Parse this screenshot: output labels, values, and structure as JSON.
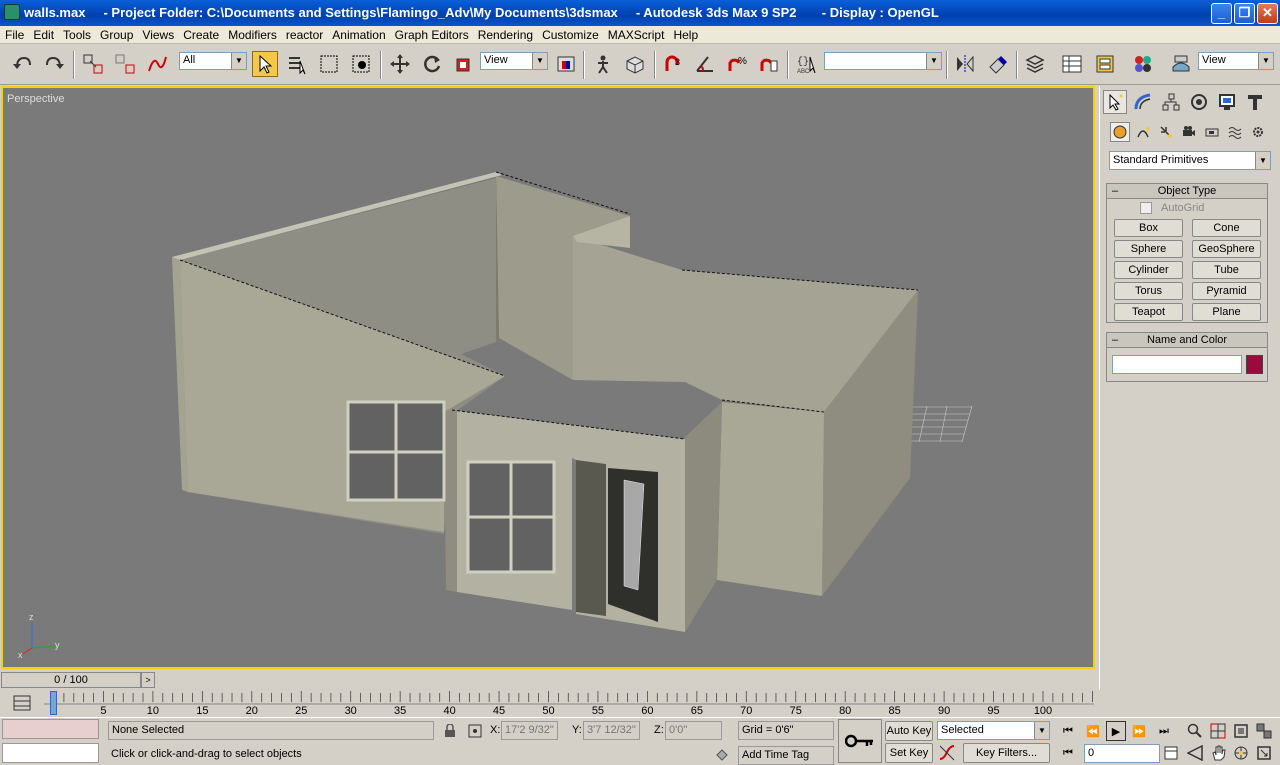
{
  "window": {
    "title": "walls.max     - Project Folder: C:\\Documents and Settings\\Flamingo_Adv\\My Documents\\3dsmax     - Autodesk 3ds Max 9 SP2       - Display : OpenGL",
    "minimize": "_",
    "maximize": "❐",
    "close": "✕"
  },
  "menu": [
    "File",
    "Edit",
    "Tools",
    "Group",
    "Views",
    "Create",
    "Modifiers",
    "reactor",
    "Animation",
    "Graph Editors",
    "Rendering",
    "Customize",
    "MAXScript",
    "Help"
  ],
  "toolbar": {
    "selection_filter": "All",
    "ref_coord": "View",
    "named_selection": "",
    "render_view": "View",
    "icons": [
      "undo-icon",
      "redo-icon",
      "select-link-icon",
      "unlink-icon",
      "bind-space-warp-icon",
      "select-object-icon",
      "select-by-name-icon",
      "rect-region-icon",
      "window-crossing-icon",
      "move-icon",
      "rotate-icon",
      "scale-icon",
      "pivot-icon",
      "manipulate-icon",
      "keyboard-shortcut-icon",
      "snaps-icon",
      "angle-snap-icon",
      "percent-snap-icon",
      "spinner-snap-icon",
      "edit-named-sets-icon",
      "mirror-icon",
      "align-icon",
      "layer-manager-icon",
      "curve-editor-icon",
      "schematic-view-icon",
      "material-editor-icon",
      "render-scene-icon",
      "quick-render-icon"
    ]
  },
  "viewport": {
    "label": "Perspective",
    "axis": {
      "x": "x",
      "y": "y",
      "z": "z"
    }
  },
  "command_panel": {
    "tabs": [
      "create-tab-icon",
      "modify-tab-icon",
      "hierarchy-tab-icon",
      "motion-tab-icon",
      "display-tab-icon",
      "utilities-tab-icon"
    ],
    "subtabs": [
      "geometry-icon",
      "shapes-icon",
      "lights-icon",
      "cameras-icon",
      "helpers-icon",
      "space-warps-icon",
      "systems-icon"
    ],
    "category": "Standard Primitives",
    "object_type": {
      "title": "Object Type",
      "autogrid": "AutoGrid",
      "buttons": [
        "Box",
        "Cone",
        "Sphere",
        "GeoSphere",
        "Cylinder",
        "Tube",
        "Torus",
        "Pyramid",
        "Teapot",
        "Plane"
      ]
    },
    "name_and_color": {
      "title": "Name and Color",
      "name_value": "",
      "color": "#9b0a3c"
    }
  },
  "time": {
    "slider": "0 / 100",
    "ticks": [
      "0",
      "5",
      "10",
      "15",
      "20",
      "25",
      "30",
      "35",
      "40",
      "45",
      "50",
      "55",
      "60",
      "65",
      "70",
      "75",
      "80",
      "85",
      "90",
      "95",
      "100"
    ]
  },
  "status": {
    "selection": "None Selected",
    "prompt": "Click or click-and-drag to select objects",
    "x_label": "X:",
    "x_value": "17'2 9/32\"",
    "y_label": "Y:",
    "y_value": "3'7 12/32\"",
    "z_label": "Z:",
    "z_value": "0'0\"",
    "grid": "Grid = 0'6\"",
    "add_time_tag": "Add Time Tag",
    "auto_key": "Auto Key",
    "set_key": "Set Key",
    "key_mode": "Selected",
    "key_filters": "Key Filters...",
    "frame": "0"
  }
}
